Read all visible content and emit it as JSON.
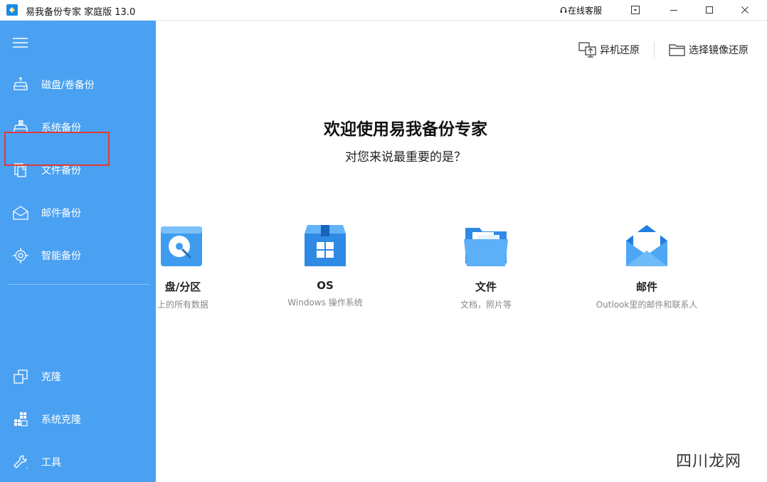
{
  "window": {
    "title": "易我备份专家 家庭版 13.0",
    "support_label": "在线客服"
  },
  "sidebar": {
    "items": [
      {
        "label": "磁盘/卷备份",
        "icon": "disk-backup-icon"
      },
      {
        "label": "系统备份",
        "icon": "system-backup-icon"
      },
      {
        "label": "文件备份",
        "icon": "file-backup-icon"
      },
      {
        "label": "邮件备份",
        "icon": "mail-backup-icon"
      },
      {
        "label": "智能备份",
        "icon": "smart-backup-icon"
      },
      {
        "label": "克隆",
        "icon": "clone-icon"
      },
      {
        "label": "系统克隆",
        "icon": "system-clone-icon"
      },
      {
        "label": "工具",
        "icon": "tools-icon"
      }
    ],
    "highlighted_item": "文件备份"
  },
  "toolbar": {
    "restore_other_label": "异机还原",
    "restore_image_label": "选择镜像还原"
  },
  "main": {
    "welcome_title": "欢迎使用易我备份专家",
    "subtitle": "对您来说最重要的是？",
    "cards": [
      {
        "title": "盘/分区",
        "desc": "上的所有数据",
        "icon": "disk-partition-icon"
      },
      {
        "title": "OS",
        "desc": "Windows 操作系统",
        "icon": "os-box-icon"
      },
      {
        "title": "文件",
        "desc": "文档，照片等",
        "icon": "folder-icon"
      },
      {
        "title": "邮件",
        "desc": "Outlook里的邮件和联系人",
        "icon": "mail-envelope-icon"
      }
    ]
  },
  "watermark": "四川龙网",
  "colors": {
    "sidebar_bg": "#4aa1f2",
    "accent_blue": "#2b8fe8",
    "highlight_red": "#e53935"
  }
}
